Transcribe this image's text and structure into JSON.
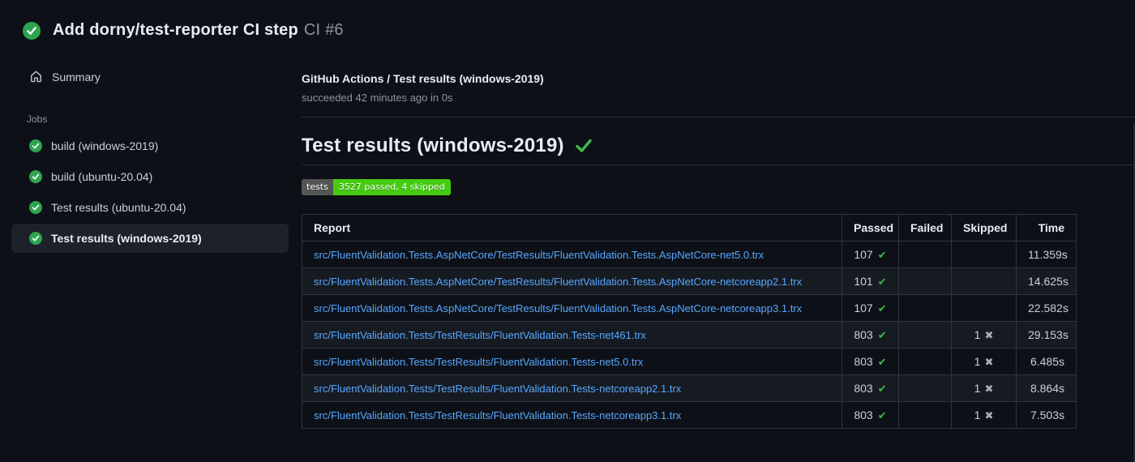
{
  "header": {
    "title": "Add dorny/test-reporter CI step",
    "run_number": "CI #6"
  },
  "sidebar": {
    "summary_label": "Summary",
    "jobs_label": "Jobs",
    "jobs": [
      {
        "label": "build (windows-2019)",
        "status": "success",
        "selected": false
      },
      {
        "label": "build (ubuntu-20.04)",
        "status": "success",
        "selected": false
      },
      {
        "label": "Test results (ubuntu-20.04)",
        "status": "success",
        "selected": false
      },
      {
        "label": "Test results (windows-2019)",
        "status": "success",
        "selected": true
      }
    ]
  },
  "main": {
    "breadcrumb": "GitHub Actions / Test results (windows-2019)",
    "status_line": "succeeded 42 minutes ago in 0s",
    "section_title": "Test results (windows-2019)",
    "badge": {
      "label": "tests",
      "value": "3527 passed, 4 skipped"
    },
    "table": {
      "columns": [
        "Report",
        "Passed",
        "Failed",
        "Skipped",
        "Time"
      ],
      "rows": [
        {
          "report": "src/FluentValidation.Tests.AspNetCore/TestResults/FluentValidation.Tests.AspNetCore-net5.0.trx",
          "passed": "107",
          "failed": "",
          "skipped": "",
          "time": "11.359s"
        },
        {
          "report": "src/FluentValidation.Tests.AspNetCore/TestResults/FluentValidation.Tests.AspNetCore-netcoreapp2.1.trx",
          "passed": "101",
          "failed": "",
          "skipped": "",
          "time": "14.625s"
        },
        {
          "report": "src/FluentValidation.Tests.AspNetCore/TestResults/FluentValidation.Tests.AspNetCore-netcoreapp3.1.trx",
          "passed": "107",
          "failed": "",
          "skipped": "",
          "time": "22.582s"
        },
        {
          "report": "src/FluentValidation.Tests/TestResults/FluentValidation.Tests-net461.trx",
          "passed": "803",
          "failed": "",
          "skipped": "1",
          "time": "29.153s"
        },
        {
          "report": "src/FluentValidation.Tests/TestResults/FluentValidation.Tests-net5.0.trx",
          "passed": "803",
          "failed": "",
          "skipped": "1",
          "time": "6.485s"
        },
        {
          "report": "src/FluentValidation.Tests/TestResults/FluentValidation.Tests-netcoreapp2.1.trx",
          "passed": "803",
          "failed": "",
          "skipped": "1",
          "time": "8.864s"
        },
        {
          "report": "src/FluentValidation.Tests/TestResults/FluentValidation.Tests-netcoreapp3.1.trx",
          "passed": "803",
          "failed": "",
          "skipped": "1",
          "time": "7.503s"
        }
      ]
    }
  },
  "icons": {
    "success_circle": "success-check-icon",
    "home": "home-icon",
    "heading_check": "check-icon",
    "pass_glyph": "✔",
    "skip_glyph": "✖"
  },
  "colors": {
    "page_bg": "#0d1117",
    "success_green": "#2ea44f",
    "check_green": "#3fb950",
    "link_blue": "#58a6ff",
    "badge_label_bg": "#555555",
    "badge_value_bg": "#44cc11",
    "row_alt_bg": "#161b22",
    "table_border": "#2f353d"
  }
}
